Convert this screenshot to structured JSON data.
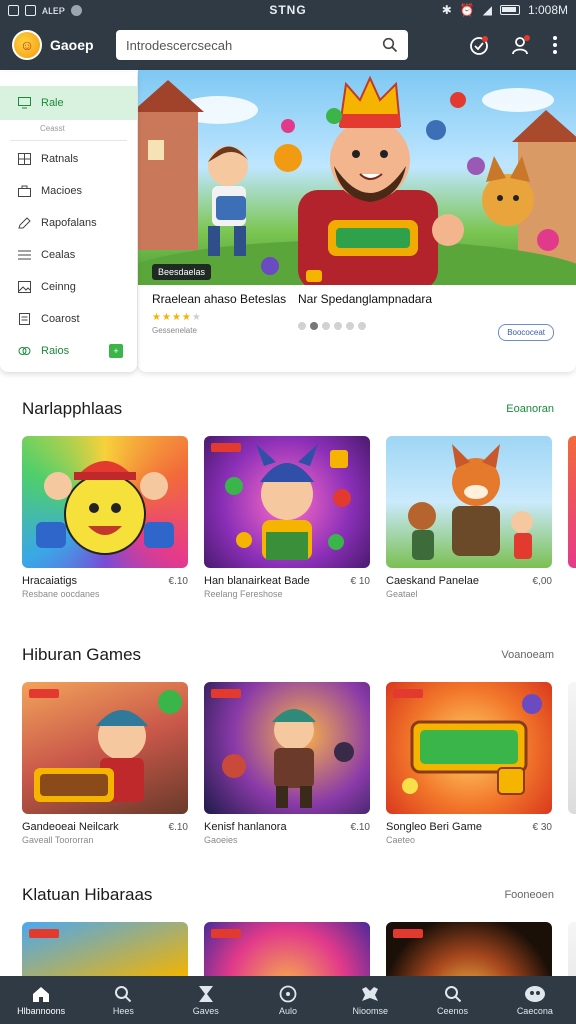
{
  "status_bar": {
    "left_text": "ᴀʟᴇᴘ",
    "center_text": "STNG",
    "time": "1:008M"
  },
  "app_bar": {
    "app_name": "Gaoep",
    "search": {
      "placeholder": "Introdescercsecah"
    }
  },
  "sidebar": {
    "items": [
      {
        "label": "Rale",
        "icon": "monitor-icon",
        "active": true
      },
      {
        "label": "Ratnals",
        "icon": "grid-icon"
      },
      {
        "label": "Macioes",
        "icon": "bag-icon"
      },
      {
        "label": "Rapofalans",
        "icon": "pencil-icon"
      },
      {
        "label": "Cealas",
        "icon": "list-icon"
      },
      {
        "label": "Ceinng",
        "icon": "image-icon"
      },
      {
        "label": "Coarost",
        "icon": "document-icon"
      },
      {
        "label": "Raios",
        "icon": "link-icon"
      }
    ],
    "sub_label": "Ceasst"
  },
  "hero": {
    "tag": "Beesdaelas",
    "title_1": "Rraelean ahaso Beteslas",
    "rating_stars": 4,
    "subtitle_1": "Gessenelate",
    "title_2": "Nar Spedanglampnadara",
    "slide_count": 6,
    "active_slide": 2,
    "button_label": "Boococeat"
  },
  "sections": [
    {
      "title": "Narlapphlaas",
      "more": "Eoanoran",
      "cards": [
        {
          "title": "Hracaiatigs",
          "price": "€.10",
          "sub": "Resbane oocdanes"
        },
        {
          "title": "Han blanairkeat Bade",
          "price": "€ 10",
          "sub": "Reelang Fereshose"
        },
        {
          "title": "Caeskand Panelae",
          "price": "€,00",
          "sub": "Geatael"
        }
      ]
    },
    {
      "title": "Hiburan Games",
      "more": "Voanoeam",
      "cards": [
        {
          "title": "Gandeoeai Neilcark",
          "price": "€.10",
          "sub": "Gaveall Toororran"
        },
        {
          "title": "Kenisf hanlanora",
          "price": "€.10",
          "sub": "Gaoeies"
        },
        {
          "title": "Songleo Beri Game",
          "price": "€ 30",
          "sub": "Caeteo"
        }
      ]
    },
    {
      "title": "Klatuan Hibaraas",
      "more": "Fooneoen",
      "cards": []
    }
  ],
  "bottom_nav": [
    {
      "label": "Hlbannoons",
      "icon": "home-icon"
    },
    {
      "label": "Hees",
      "icon": "search-icon"
    },
    {
      "label": "Gaves",
      "icon": "hourglass-icon"
    },
    {
      "label": "Aulo",
      "icon": "target-icon"
    },
    {
      "label": "Nioomse",
      "icon": "controller-icon"
    },
    {
      "label": "Ceenos",
      "icon": "search-icon"
    },
    {
      "label": "Caecona",
      "icon": "profile-icon"
    }
  ],
  "colors": {
    "bar": "#2f3a44",
    "accent_green": "#1b8b3a",
    "active_tint": "#d9f2df"
  }
}
